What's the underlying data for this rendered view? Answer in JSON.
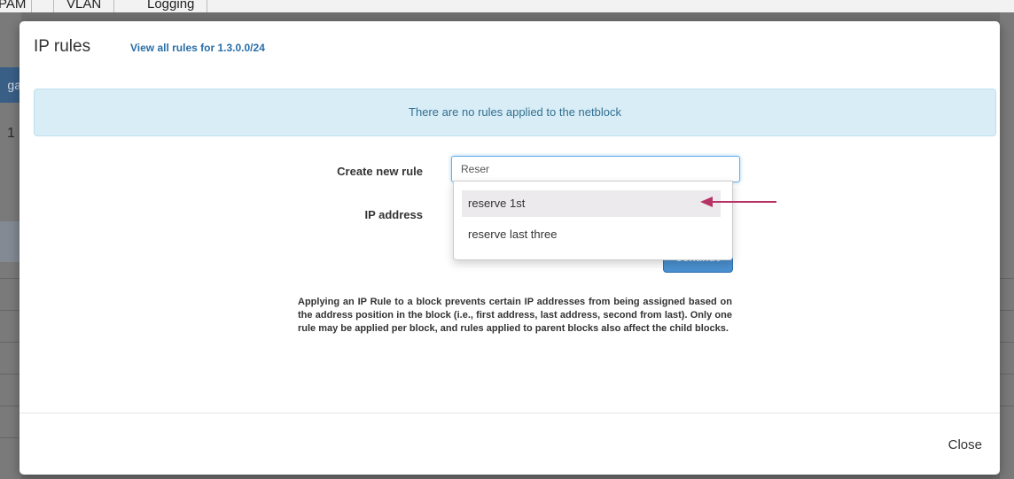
{
  "background": {
    "tabs": [
      "PAM",
      "VLAN",
      "Logging"
    ],
    "left_partial_text": "ga",
    "left_partial_number": "1"
  },
  "modal": {
    "title": "IP rules",
    "view_all_link": "View all rules for 1.3.0.0/24",
    "alert_text": "There are no rules applied to the netblock",
    "create_rule_label": "Create new rule",
    "create_rule_value": "Reser",
    "ip_address_label": "IP address",
    "continue_label": "Continue",
    "dropdown_options": [
      "reserve 1st",
      "reserve last three"
    ],
    "help_text": "Applying an IP Rule to a block prevents certain IP addresses from being assigned based on the address position in the block (i.e., first address, last address, second from last). Only one rule may be applied per block, and rules applied to parent blocks also affect the child blocks.",
    "close_label": "Close"
  },
  "colors": {
    "alert_bg": "#d9edf7",
    "alert_text": "#31708f",
    "link": "#2a6ea8",
    "arrow": "#b83265",
    "active_option_bg": "#eceaec"
  }
}
